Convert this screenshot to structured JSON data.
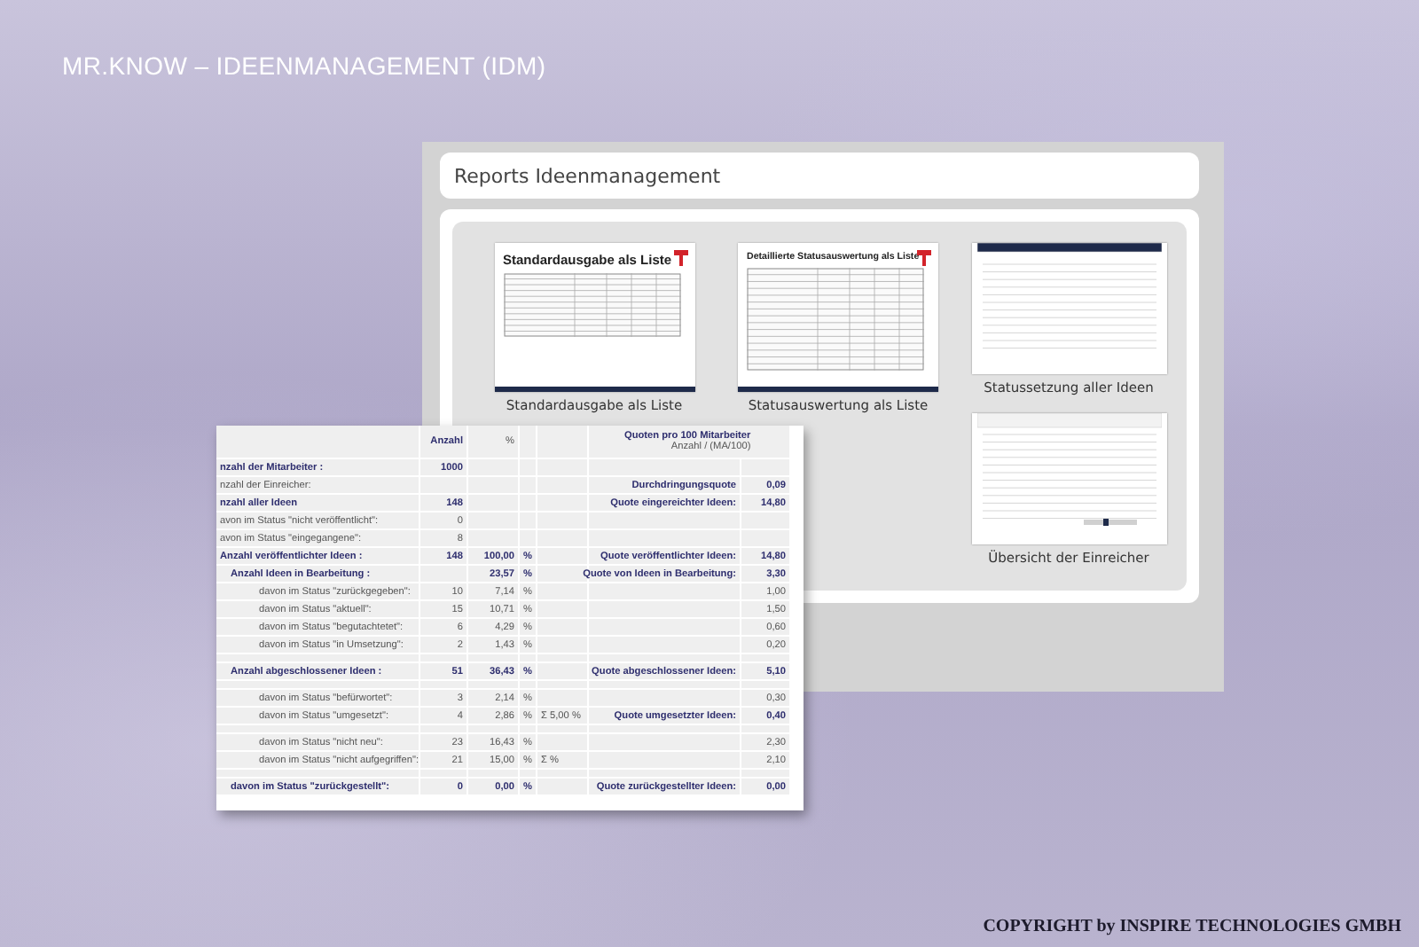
{
  "slide": {
    "title": "MR.KNOW – IDEENMANAGEMENT (IDM)",
    "copyright": "COPYRIGHT by INSPIRE TECHNOLOGIES GMBH"
  },
  "reports_panel": {
    "title": "Reports Ideenmanagement",
    "reports": [
      {
        "kind": "document",
        "heading": "Standardausgabe als Liste",
        "label": "Standardausgabe als Liste"
      },
      {
        "kind": "document",
        "heading": "Detaillierte Statusauswertung als Liste",
        "label": "Statusauswertung als Liste"
      },
      {
        "kind": "screen",
        "label": "Statussetzung aller Ideen"
      },
      {
        "kind": "screen",
        "label": "Übersicht der Einreicher"
      }
    ]
  },
  "report_table": {
    "headers": {
      "count": "Anzahl",
      "percent": "%",
      "quote": "Quoten pro 100 Mitarbeiter",
      "quote_sub": "Anzahl / (MA/100)"
    },
    "rows": [
      {
        "kind": "main",
        "label": "nzahl der Mitarbeiter :",
        "count": "1000"
      },
      {
        "kind": "plain",
        "label": "nzahl der Einreicher:",
        "quote_label": "Durchdringungsquote",
        "quote_value": "0,09"
      },
      {
        "kind": "main",
        "label": "nzahl aller Ideen",
        "count": "148",
        "quote_label": "Quote eingereichter Ideen:",
        "quote_value": "14,80"
      },
      {
        "kind": "plain",
        "label": "avon im Status \"nicht veröffentlicht\":",
        "count": "0"
      },
      {
        "kind": "plain",
        "label": "avon im Status \"eingegangene\":",
        "count": "8"
      },
      {
        "kind": "main",
        "label": "Anzahl veröffentlichter Ideen :",
        "count": "148",
        "percent": "100,00",
        "unit": "%",
        "quote_label": "Quote veröffentlichter Ideen:",
        "quote_value": "14,80"
      },
      {
        "kind": "sub",
        "label": "Anzahl Ideen in Bearbeitung :",
        "percent": "23,57",
        "unit": "%",
        "quote_label": "Quote von Ideen in Bearbeitung:",
        "quote_value": "3,30"
      },
      {
        "kind": "detail",
        "label": "davon im Status \"zurückgegeben\":",
        "count": "10",
        "percent": "7,14",
        "unit": "%",
        "quote_value": "1,00"
      },
      {
        "kind": "detail",
        "label": "davon im Status \"aktuell\":",
        "count": "15",
        "percent": "10,71",
        "unit": "%",
        "quote_value": "1,50"
      },
      {
        "kind": "detail",
        "label": "davon im Status \"begutachtetet\":",
        "count": "6",
        "percent": "4,29",
        "unit": "%",
        "quote_value": "0,60"
      },
      {
        "kind": "detail",
        "label": "davon im Status \"in Umsetzung\":",
        "count": "2",
        "percent": "1,43",
        "unit": "%",
        "quote_value": "0,20"
      },
      {
        "kind": "sub",
        "spaced": true,
        "label": "Anzahl abgeschlossener Ideen :",
        "count": "51",
        "percent": "36,43",
        "unit": "%",
        "quote_label": "Quote abgeschlossener Ideen:",
        "quote_value": "5,10"
      },
      {
        "kind": "detail",
        "spaced": true,
        "label": "davon im Status \"befürwortet\":",
        "count": "3",
        "percent": "2,14",
        "unit": "%",
        "quote_value": "0,30"
      },
      {
        "kind": "detail",
        "label": "davon im Status \"umgesetzt\":",
        "count": "4",
        "percent": "2,86",
        "unit": "%",
        "sum": "Σ  5,00 %",
        "quote_label": "Quote umgesetzter Ideen:",
        "quote_value": "0,40"
      },
      {
        "kind": "detail",
        "spaced": true,
        "label": "davon im Status \"nicht neu\":",
        "count": "23",
        "percent": "16,43",
        "unit": "%",
        "quote_value": "2,30"
      },
      {
        "kind": "detail",
        "label": "davon im Status \"nicht aufgegriffen\":",
        "count": "21",
        "percent": "15,00",
        "unit": "%",
        "sum": "Σ  %",
        "quote_value": "2,10"
      },
      {
        "kind": "sub",
        "spaced": true,
        "label": "davon im Status \"zurückgestellt\":",
        "count": "0",
        "percent": "0,00",
        "unit": "%",
        "quote_label": "Quote zurückgestellter Ideen:",
        "quote_value": "0,00"
      }
    ]
  }
}
